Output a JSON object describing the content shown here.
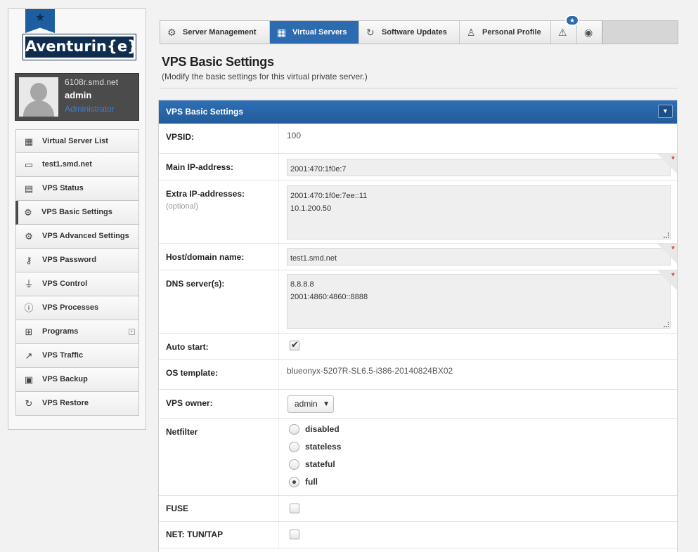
{
  "brand": {
    "name": "Aventurin{e}"
  },
  "user": {
    "host": "6108r.smd.net",
    "name": "admin",
    "role": "Administrator"
  },
  "sidebar": {
    "items": [
      {
        "label": "Virtual Server List",
        "icon": "list-icon"
      },
      {
        "label": "test1.smd.net",
        "icon": "laptop-icon"
      },
      {
        "label": "VPS Status",
        "icon": "briefcase-icon"
      },
      {
        "label": "VPS Basic Settings",
        "icon": "gear-icon"
      },
      {
        "label": "VPS Advanced Settings",
        "icon": "gears-icon"
      },
      {
        "label": "VPS Password",
        "icon": "key-icon"
      },
      {
        "label": "VPS Control",
        "icon": "plug-icon"
      },
      {
        "label": "VPS Processes",
        "icon": "info-icon"
      },
      {
        "label": "Programs",
        "icon": "sitemap-icon"
      },
      {
        "label": "VPS Traffic",
        "icon": "chart-icon"
      },
      {
        "label": "VPS Backup",
        "icon": "backup-icon"
      },
      {
        "label": "VPS Restore",
        "icon": "refresh-icon"
      }
    ]
  },
  "topnav": {
    "tabs": [
      {
        "label": "Server Management",
        "icon": "gear-icon"
      },
      {
        "label": "Virtual Servers",
        "icon": "grid-icon"
      },
      {
        "label": "Software Updates",
        "icon": "refresh-icon"
      },
      {
        "label": "Personal Profile",
        "icon": "user-icon"
      }
    ],
    "notification_badge": "★"
  },
  "page": {
    "title": "VPS Basic Settings",
    "subtitle": "(Modify the basic settings for this virtual private server.)"
  },
  "panel": {
    "title": "VPS Basic Settings",
    "fields": {
      "vpsid": {
        "label": "VPSID:",
        "value": "100"
      },
      "main_ip": {
        "label": "Main IP-address:",
        "value": "2001:470:1f0e:7"
      },
      "extra_ip": {
        "label": "Extra IP-addresses:",
        "hint": "(optional)",
        "value": "2001:470:1f0e:7ee::11\n10.1.200.50"
      },
      "hostname": {
        "label": "Host/domain name:",
        "value": "test1.smd.net"
      },
      "dns": {
        "label": "DNS server(s):",
        "value": "8.8.8.8\n2001:4860:4860::8888"
      },
      "auto_start": {
        "label": "Auto start:",
        "checked": true
      },
      "os_template": {
        "label": "OS template:",
        "value": "blueonyx-5207R-SL6.5-i386-20140824BX02"
      },
      "vps_owner": {
        "label": "VPS owner:",
        "value": "admin"
      },
      "netfilter": {
        "label": "Netfilter",
        "options": [
          "disabled",
          "stateless",
          "stateful",
          "full"
        ],
        "selected": "full"
      },
      "fuse": {
        "label": "FUSE",
        "checked": false
      },
      "tun_tap": {
        "label": "NET: TUN/TAP",
        "checked": false
      }
    }
  },
  "colors": {
    "accent": "#2c6bb0",
    "required": "#cc0000"
  }
}
